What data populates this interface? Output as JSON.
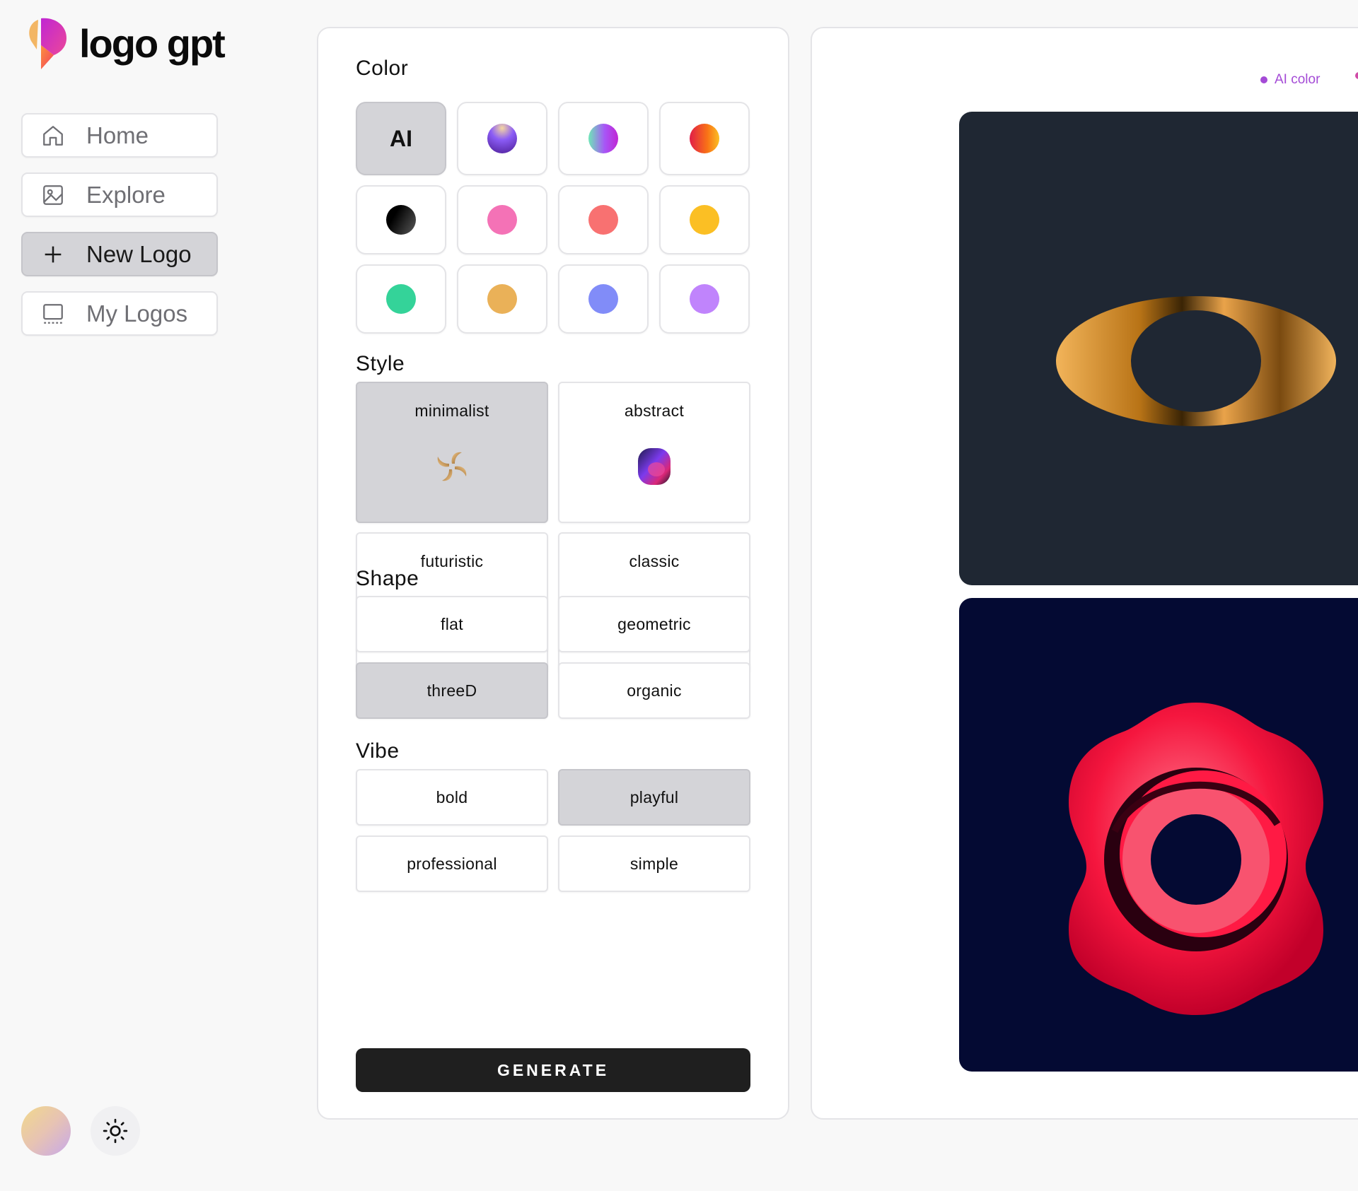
{
  "brand": {
    "name": "logo gpt"
  },
  "sidebar": {
    "items": [
      {
        "label": "Home",
        "icon": "home-icon",
        "active": false
      },
      {
        "label": "Explore",
        "icon": "image-icon",
        "active": false
      },
      {
        "label": "New Logo",
        "icon": "plus-icon",
        "active": true
      },
      {
        "label": "My Logos",
        "icon": "monitor-icon",
        "active": false
      }
    ]
  },
  "options": {
    "color": {
      "title": "Color",
      "ai_label": "AI",
      "swatches": [
        {
          "name": "ai",
          "selected": true
        },
        {
          "name": "violet-gradient",
          "colors": [
            "#f5d7a1",
            "#7c3aed",
            "#4c1d95"
          ]
        },
        {
          "name": "teal-purple-gradient",
          "colors": [
            "#6ee7b7",
            "#a855f7",
            "#c026d3"
          ]
        },
        {
          "name": "pink-orange-gradient",
          "colors": [
            "#e11d48",
            "#f97316",
            "#fbbf24"
          ]
        },
        {
          "name": "black",
          "colors": [
            "#000000",
            "#4b4b4b"
          ]
        },
        {
          "name": "pink",
          "colors": [
            "#f472b6"
          ]
        },
        {
          "name": "coral",
          "colors": [
            "#f87171"
          ]
        },
        {
          "name": "yellow",
          "colors": [
            "#fbbf24"
          ]
        },
        {
          "name": "green",
          "colors": [
            "#34d399"
          ]
        },
        {
          "name": "amber",
          "colors": [
            "#eab158"
          ]
        },
        {
          "name": "periwinkle",
          "colors": [
            "#818cf8"
          ]
        },
        {
          "name": "lavender",
          "colors": [
            "#c084fc"
          ]
        }
      ]
    },
    "style": {
      "title": "Style",
      "items": [
        {
          "label": "minimalist",
          "selected": true,
          "icon": "swirl-logo-icon"
        },
        {
          "label": "abstract",
          "selected": false,
          "icon": "gradient-blob-icon"
        },
        {
          "label": "futuristic",
          "selected": false,
          "icon": "flower-logo-icon"
        },
        {
          "label": "classic",
          "selected": false,
          "icon": "star-globe-icon"
        }
      ]
    },
    "shape": {
      "title": "Shape",
      "items": [
        {
          "label": "flat",
          "selected": false
        },
        {
          "label": "geometric",
          "selected": false
        },
        {
          "label": "threeD",
          "selected": true
        },
        {
          "label": "organic",
          "selected": false
        }
      ]
    },
    "vibe": {
      "title": "Vibe",
      "items": [
        {
          "label": "bold",
          "selected": false
        },
        {
          "label": "playful",
          "selected": true
        },
        {
          "label": "professional",
          "selected": false
        },
        {
          "label": "simple",
          "selected": false
        }
      ]
    },
    "generate_label": "GENERATE"
  },
  "preview": {
    "tags": [
      "AI color"
    ],
    "accent": "#a44bd6",
    "logos": [
      {
        "name": "gold-ring-logo",
        "background": "#1f2733"
      },
      {
        "name": "red-ring-logo",
        "background": "#040a33"
      }
    ]
  }
}
